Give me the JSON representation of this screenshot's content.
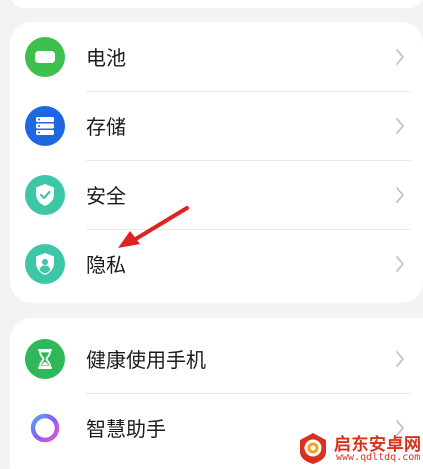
{
  "colors": {
    "battery": "#3dc04d",
    "storage": "#1d67e0",
    "security": "#3ec7a6",
    "privacy": "#3ec7a6",
    "health": "#2fb85a",
    "assistant_ring": "#8a5cf5",
    "arrow": "#e02121",
    "watermark": "#d8321f"
  },
  "group1": {
    "items": [
      {
        "label": "电池",
        "icon": "battery-icon"
      },
      {
        "label": "存储",
        "icon": "storage-icon"
      },
      {
        "label": "安全",
        "icon": "shield-check-icon"
      },
      {
        "label": "隐私",
        "icon": "privacy-shield-icon"
      }
    ]
  },
  "group2": {
    "items": [
      {
        "label": "健康使用手机",
        "icon": "hourglass-icon"
      },
      {
        "label": "智慧助手",
        "icon": "assistant-ring-icon"
      }
    ]
  },
  "watermark": {
    "title": "启东安卓网",
    "url": "www.qdltdq.com"
  }
}
